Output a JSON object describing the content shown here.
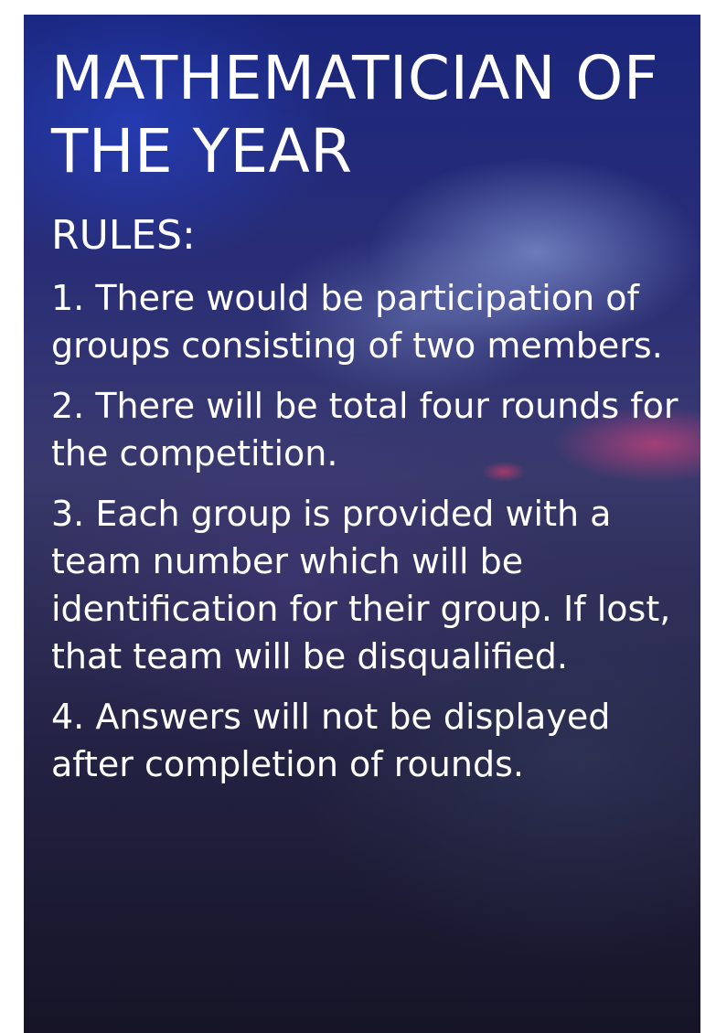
{
  "poster": {
    "title": "MATHEMATICIAN OF THE YEAR",
    "rules_heading": "RULES:",
    "rules": [
      "1. There would be participation of groups consisting of two members.",
      "2. There will be total four rounds for the competition.",
      "3. Each group is provided with a team number which will be identification for their group. If lost, that team will be disqualified.",
      "4. Answers will not be displayed after completion of rounds."
    ]
  },
  "colors": {
    "text": "#ffffff",
    "background_top": "#1d2a8a",
    "background_bottom": "#1d1b33",
    "accent_pink": "#ff4682"
  }
}
